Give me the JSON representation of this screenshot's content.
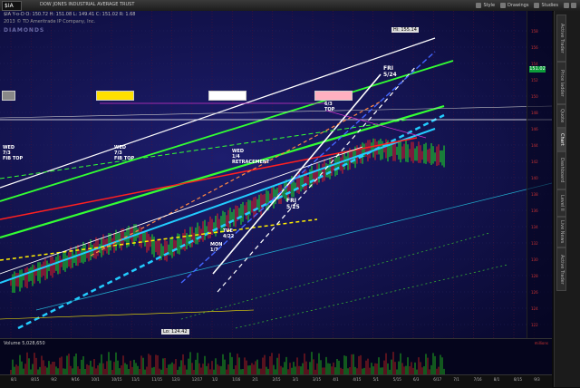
{
  "header": {
    "symbol": "$IA",
    "description": "DOW JONES INDUSTRIAL AVERAGE TRUST",
    "toolbar": [
      "Style",
      "Drawings",
      "Studies"
    ]
  },
  "chart": {
    "info_line": "$IA Y-o-D  O: 150.72  H: 151.08  L: 149.41  C: 151.02  R: 1.68",
    "sub_line": "2013 © TD Ameritrade IP Company, Inc.",
    "watermark": "DIAMONDS",
    "hi_label": "Hi: 155.14",
    "lo_label": "Lo: 124.42",
    "last_price": "151.02",
    "price_ticks": [
      "158",
      "156",
      "154",
      "152",
      "150",
      "148",
      "146",
      "144",
      "142",
      "140",
      "138",
      "136",
      "134",
      "132",
      "130",
      "128",
      "126",
      "124",
      "122"
    ],
    "annotations": [
      {
        "id": "wed-7-3",
        "text": "WED\n7/3\nFIB TOP"
      },
      {
        "id": "wed-7-3b",
        "text": "WED\n7/3\nFIB TOP"
      },
      {
        "id": "wed-1-4",
        "text": "WED\n1/4\nRETRACEMENT"
      },
      {
        "id": "fri-5-24",
        "text": "FRI\n5/24"
      },
      {
        "id": "fri-5-25",
        "text": "FRI\n5/25"
      },
      {
        "id": "mon-1-7",
        "text": "MON\n1/7"
      },
      {
        "id": "tue-4-22",
        "text": "TUE\n4/22"
      },
      {
        "id": "ba-top",
        "text": "6/3\nTOP"
      }
    ]
  },
  "volume": {
    "label": "Volume",
    "value": "5,028,650",
    "scale": "millions"
  },
  "time_axis": {
    "labels": [
      "8/1",
      "8/15",
      "9/2",
      "9/16",
      "10/1",
      "10/15",
      "11/1",
      "11/15",
      "12/3",
      "12/17",
      "1/2",
      "1/16",
      "2/1",
      "2/15",
      "3/1",
      "3/15",
      "4/1",
      "4/15",
      "5/1",
      "5/15",
      "6/3",
      "6/17",
      "7/1",
      "7/16",
      "8/1",
      "8/15",
      "9/3"
    ]
  },
  "right_tabs": [
    "Active Trader",
    "Price ladder",
    "Quote",
    "Chart",
    "Dashboard",
    "Level II",
    "Live News",
    "Active Trader"
  ],
  "colors": {
    "background": "#111148",
    "green": "#33ff33",
    "cyan": "#22ccff",
    "white": "#ffffff",
    "yellow": "#ffee00",
    "red": "#ff2222",
    "magenta": "#cc33cc"
  }
}
